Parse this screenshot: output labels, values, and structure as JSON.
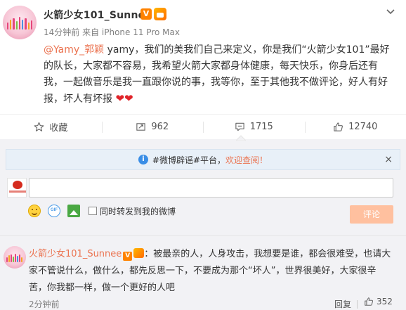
{
  "post": {
    "author": "火箭少女101_Sunnee",
    "verified_badge": "V",
    "meta": "14分钟前 来自 iPhone 11 Pro Max",
    "mention": "@Yamy_郭颖",
    "body": " yamy，我们的美我们自己来定义，你是我们“火箭少女101”最好的队长，大家都不容易，我希望火箭大家都身体健康，每天快乐，你身后还有我，一起做音乐是我一直跟你说的事，我等你，至于其他我不做评论，好人有好报，坏人有坏报",
    "hearts": "❤❤"
  },
  "actions": [
    {
      "label": "收藏",
      "icon": "star-icon"
    },
    {
      "label": "962",
      "icon": "repost-icon"
    },
    {
      "label": "1715",
      "icon": "comment-icon"
    },
    {
      "label": "12740",
      "icon": "like-icon"
    }
  ],
  "notice": {
    "icon": "info-icon",
    "prefix": "#微博辟谣#平台，",
    "link": "欢迎查阅！",
    "close": "×"
  },
  "composer": {
    "placeholder": "",
    "repost_label": "同时转发到我的微博",
    "submit_label": "评论"
  },
  "comment": {
    "author": "火箭少女101_Sunnee",
    "verified_badge": "V",
    "text": "：被最亲的人，人身攻击，我想要是谁，都会很难受，也请大家不管说什么，做什么，都先反思一下，不要成为那个“坏人”，世界很美好，大家很辛苦，你我都一样，做一个更好的人吧",
    "time": "2分钟前",
    "reply_label": "回复",
    "likes": "352"
  },
  "colors": {
    "accent": "#eb7350",
    "brand_orange": "#ff8200",
    "submit_disabled": "#ffc09f",
    "notice_bg": "#e8f0f8"
  }
}
